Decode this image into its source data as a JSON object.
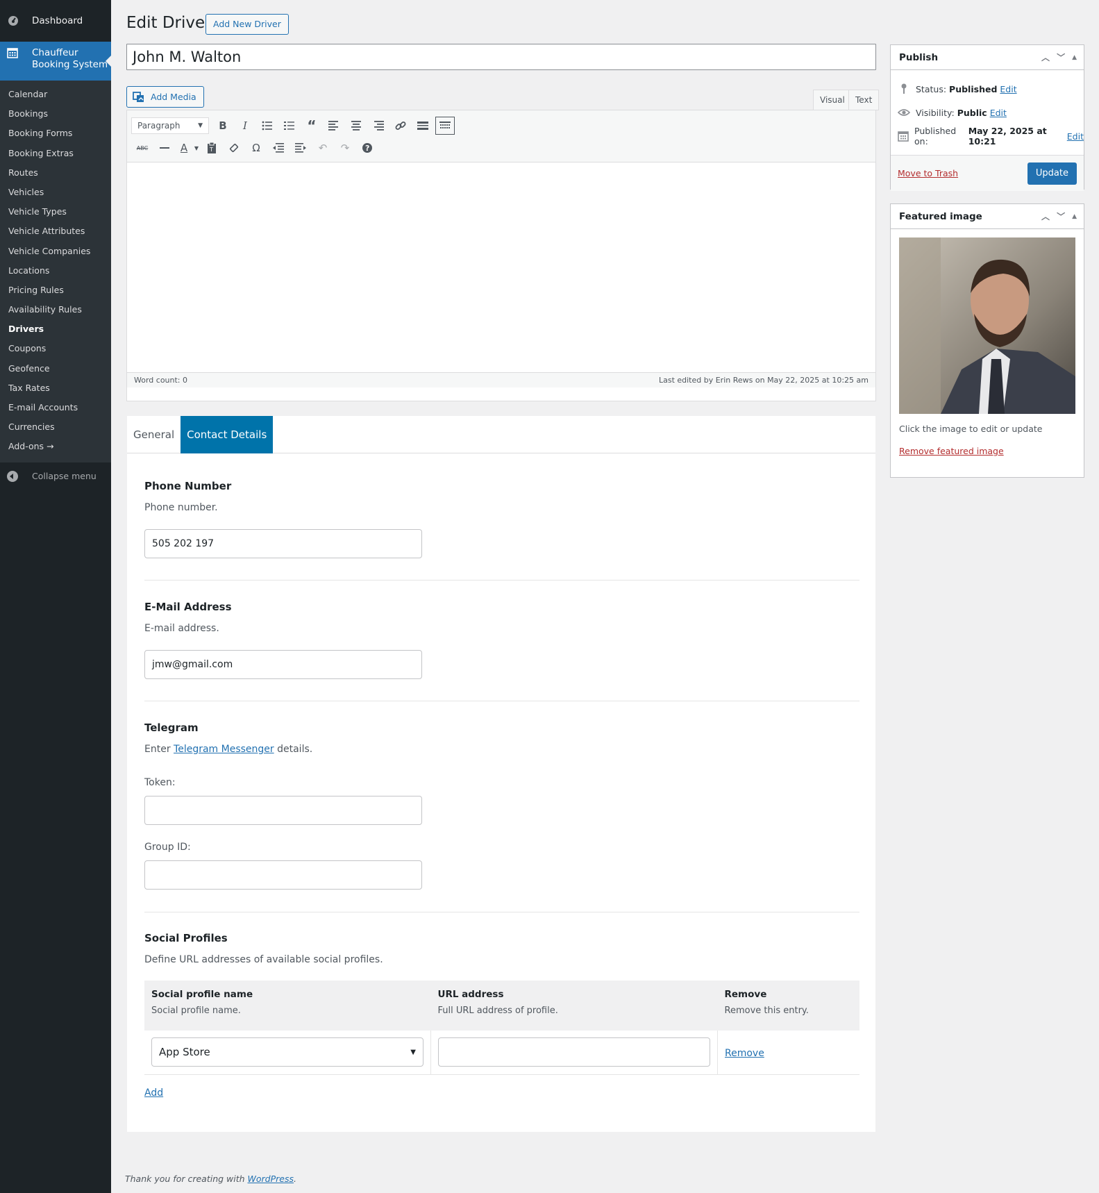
{
  "sidebar": {
    "dashboard": "Dashboard",
    "active_menu": "Chauffeur Booking System",
    "items": [
      "Calendar",
      "Bookings",
      "Booking Forms",
      "Booking Extras",
      "Routes",
      "Vehicles",
      "Vehicle Types",
      "Vehicle Attributes",
      "Vehicle Companies",
      "Locations",
      "Pricing Rules",
      "Availability Rules",
      "Drivers",
      "Coupons",
      "Geofence",
      "Tax Rates",
      "E-mail Accounts",
      "Currencies",
      "Add-ons →"
    ],
    "current_item": "Drivers",
    "collapse": "Collapse menu"
  },
  "header": {
    "title": "Edit Driver",
    "add_new": "Add New Driver"
  },
  "post_title": "John M. Walton",
  "editor": {
    "add_media": "Add Media",
    "tab_visual": "Visual",
    "tab_text": "Text",
    "format_select": "Paragraph",
    "word_count": "Word count: 0",
    "last_edited": "Last edited by Erin Rews on May 22, 2025 at 10:25 am"
  },
  "meta": {
    "tabs": [
      "General",
      "Contact Details"
    ],
    "active_tab": "Contact Details",
    "phone": {
      "title": "Phone Number",
      "desc": "Phone number.",
      "value": "505 202 197"
    },
    "email": {
      "title": "E-Mail Address",
      "desc": "E-mail address.",
      "value": "jmw@gmail.com"
    },
    "telegram": {
      "title": "Telegram",
      "desc_prefix": "Enter ",
      "desc_link": "Telegram Messenger",
      "desc_suffix": " details.",
      "token_label": "Token:",
      "token_value": "",
      "group_label": "Group ID:",
      "group_value": ""
    },
    "social": {
      "title": "Social Profiles",
      "desc": "Define URL addresses of available social profiles.",
      "columns": [
        {
          "name": "Social profile name",
          "desc": "Social profile name."
        },
        {
          "name": "URL address",
          "desc": "Full URL address of profile."
        },
        {
          "name": "Remove",
          "desc": "Remove this entry."
        }
      ],
      "rows": [
        {
          "profile": "App Store",
          "url": "",
          "remove": "Remove"
        }
      ],
      "add": "Add"
    }
  },
  "publish": {
    "title": "Publish",
    "status_label": "Status:",
    "status_value": "Published",
    "visibility_label": "Visibility:",
    "visibility_value": "Public",
    "published_label": "Published on:",
    "published_value": "May 22, 2025 at 10:21",
    "edit": "Edit",
    "trash": "Move to Trash",
    "update": "Update"
  },
  "featured": {
    "title": "Featured image",
    "hint": "Click the image to edit or update",
    "remove": "Remove featured image"
  },
  "footer": {
    "prefix": "Thank you for creating with ",
    "link": "WordPress",
    "suffix": "."
  },
  "colors": {
    "accent": "#2271b1",
    "sidebar_bg": "#1d2327",
    "active_tab": "#0073aa",
    "danger": "#b32d2e"
  }
}
